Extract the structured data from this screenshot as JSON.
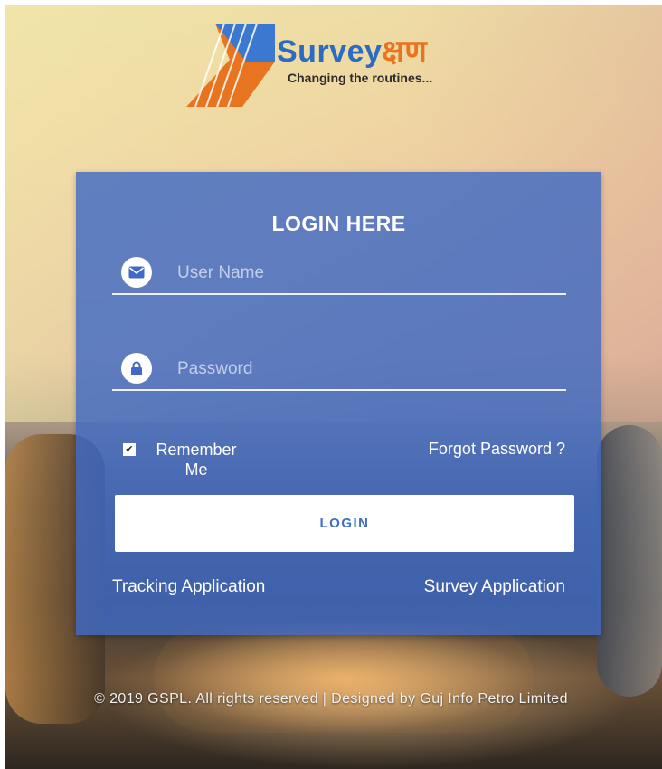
{
  "brand": {
    "name_latin": "Survey",
    "name_devanagari": "क्षण",
    "tagline": "Changing the routines...",
    "colors": {
      "blue": "#2b6bc2",
      "orange": "#e8741f"
    }
  },
  "login_form": {
    "title": "LOGIN HERE",
    "username": {
      "placeholder": "User Name",
      "value": "",
      "icon": "envelope-icon"
    },
    "password": {
      "placeholder": "Password",
      "value": "",
      "icon": "lock-icon"
    },
    "remember_me": {
      "label": "Remember Me",
      "checked": true
    },
    "forgot_password": "Forgot Password ?",
    "login_button": "LOGIN",
    "card_color": "#406ac4"
  },
  "links": {
    "tracking": "Tracking Application",
    "survey": "Survey Application"
  },
  "footer": {
    "text": "© 2019 GSPL. All rights reserved | Designed by Guj Info Petro Limited"
  }
}
